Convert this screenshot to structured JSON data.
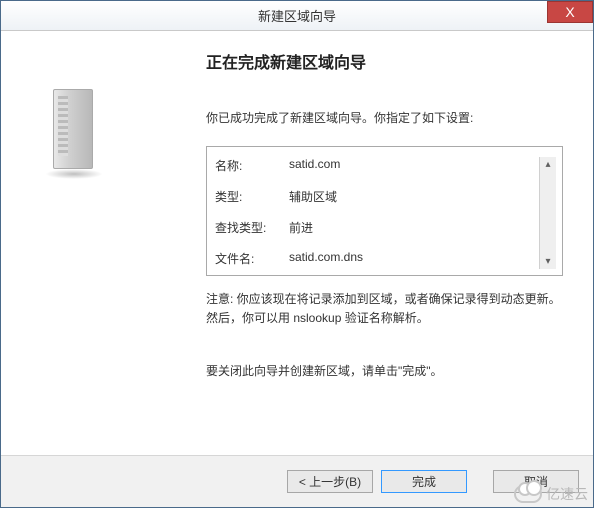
{
  "titlebar": {
    "title": "新建区域向导",
    "close_glyph": "X"
  },
  "main": {
    "heading": "正在完成新建区域向导",
    "intro": "你已成功完成了新建区域向导。你指定了如下设置:",
    "rows": [
      {
        "label": "名称:",
        "value": "satid.com"
      },
      {
        "label": "类型:",
        "value": "辅助区域"
      },
      {
        "label": "查找类型:",
        "value": "前进"
      },
      {
        "label": "文件名:",
        "value": "satid.com.dns"
      }
    ],
    "note": "注意: 你应该现在将记录添加到区域，或者确保记录得到动态更新。然后，你可以用 nslookup 验证名称解析。",
    "closing": "要关闭此向导并创建新区域，请单击\"完成\"。"
  },
  "footer": {
    "back": "< 上一步(B)",
    "finish": "完成",
    "cancel": "取消"
  },
  "watermark": "亿速云"
}
